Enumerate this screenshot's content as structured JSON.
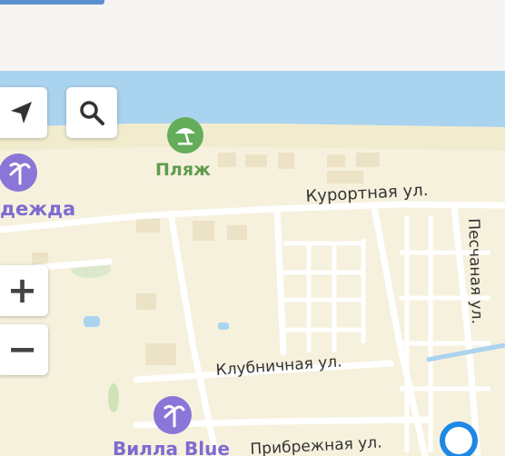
{
  "map": {
    "poi": [
      {
        "name": "Пляж",
        "icon": "beach-umbrella-icon"
      },
      {
        "name": "дежда",
        "icon": "palm-tree-icon"
      },
      {
        "name": "Вилла Blue",
        "icon": "palm-tree-icon"
      }
    ],
    "streets": [
      "Курортная ул.",
      "Песчаная ул.",
      "Клубничная ул.",
      "Прибрежная ул."
    ],
    "controls": {
      "locate_icon": "navigation-arrow-icon",
      "search_icon": "search-icon",
      "zoom_in_label": "+",
      "zoom_out_label": "−"
    },
    "colors": {
      "sea": "#aad3ef",
      "sand": "#f2eccf",
      "land": "#f6f1dd",
      "road": "#ffffff",
      "green_poi": "#64ad5a",
      "purple_poi": "#8a76d6",
      "location_ring": "#1e88e5"
    }
  }
}
